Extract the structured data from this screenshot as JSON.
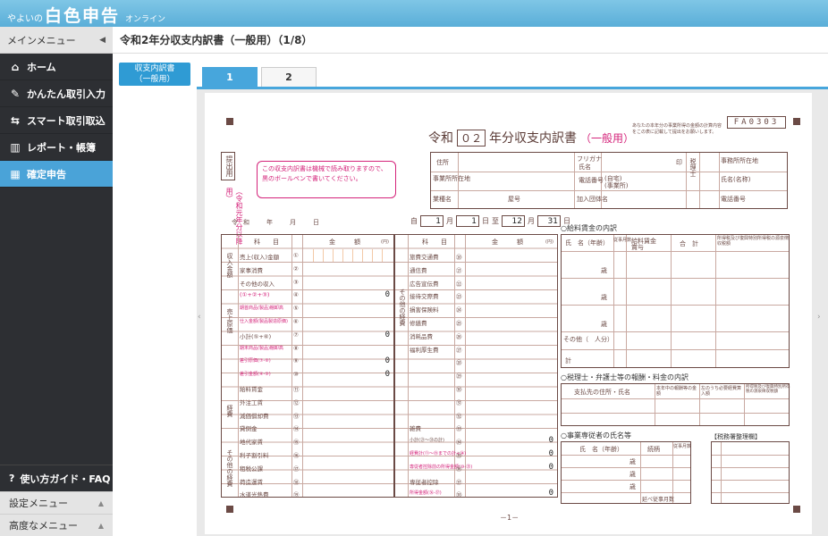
{
  "header": {
    "logo_small": "やよいの",
    "logo_big": "白色申告",
    "logo_online": "オンライン"
  },
  "sidebar": {
    "title": "メインメニュー",
    "collapse_icon": "triangle-left-icon",
    "items": [
      {
        "label": "ホーム",
        "icon": "home-icon"
      },
      {
        "label": "かんたん取引入力",
        "icon": "pencil-icon"
      },
      {
        "label": "スマート取引取込",
        "icon": "import-icon"
      },
      {
        "label": "レポート・帳簿",
        "icon": "chart-icon"
      },
      {
        "label": "確定申告",
        "icon": "calculator-icon"
      }
    ],
    "guide_label": "使い方ガイド・FAQ",
    "settings_label": "設定メニュー",
    "advanced_label": "高度なメニュー"
  },
  "main": {
    "page_title": "令和2年分収支内訳書（一般用）（1/8）",
    "doc_button": [
      "収支内訳書",
      "（一般用）"
    ],
    "tabs": [
      "1",
      "2"
    ],
    "active_tab": 0
  },
  "form": {
    "form_code": "FA0303",
    "title_prefix": "令和",
    "title_year": "０２",
    "title_main": "年分収支内訳書",
    "title_sub": "（一般用）",
    "corner_note": "あなたの本年分の事業所得の金額の計算内容をこの表に記載して提出をお願いします。",
    "teishutsu": "提出用",
    "side_note": "（令和元年分以降用）",
    "notice": "この収支内訳書は機械で読み取りますので、黒のボールペンで書いてください。",
    "info_labels": {
      "address": "住所",
      "furigana": "フリガナ",
      "name": "氏名",
      "office_address": "事業所所在地",
      "phone": "電話番号",
      "self": "(自宅)",
      "office": "(事業所)",
      "tax_accountant": "税理士",
      "office_loc": "事務所所在地",
      "tax_name": "氏名(名称)",
      "tax_phone": "電話番号",
      "business": "業種名",
      "shop": "屋号",
      "association": "加入団体名",
      "seal": "印"
    },
    "date_line": "令和　年　月　日",
    "period": {
      "from_label": "自",
      "from_month": "1",
      "month": "月",
      "from_day": "1",
      "day": "日",
      "to_label": "至",
      "to_month": "12",
      "to_day": "31"
    },
    "col_headers": {
      "item": "科　　目",
      "amount": "金　　　額",
      "yen": "(円)"
    },
    "left_rows": [
      {
        "no": "①",
        "label": "売上(収入)金額",
        "value": ""
      },
      {
        "no": "②",
        "label": "家事消費",
        "value": ""
      },
      {
        "no": "③",
        "label": "その他の収入",
        "value": ""
      },
      {
        "no": "④",
        "label": "(①+②+③)",
        "value": "0"
      },
      {
        "no": "⑤",
        "label": "期首商品(製品)棚卸高",
        "value": ""
      },
      {
        "no": "⑥",
        "label": "仕入金額(製品製造原価)",
        "value": ""
      },
      {
        "no": "⑦",
        "label": "小計(⑤+⑥)",
        "value": "0"
      },
      {
        "no": "⑧",
        "label": "期末商品(製品)棚卸高",
        "value": ""
      },
      {
        "no": "⑨",
        "label": "差引原価(⑦-⑧)",
        "value": "0"
      },
      {
        "no": "⑩",
        "label": "差引金額(④-⑨)",
        "value": "0"
      },
      {
        "no": "⑪",
        "label": "給料賃金",
        "value": ""
      },
      {
        "no": "⑫",
        "label": "外注工賃",
        "value": ""
      },
      {
        "no": "⑬",
        "label": "減価償却費",
        "value": ""
      },
      {
        "no": "⑭",
        "label": "貸倒金",
        "value": ""
      },
      {
        "no": "⑮",
        "label": "地代家賃",
        "value": ""
      },
      {
        "no": "⑯",
        "label": "利子割引料",
        "value": ""
      },
      {
        "no": "⑰",
        "label": "租税公課",
        "value": ""
      },
      {
        "no": "⑱",
        "label": "荷造運賃",
        "value": ""
      },
      {
        "no": "⑲",
        "label": "水道光熱費",
        "value": ""
      }
    ],
    "left_groups": [
      "収入金額",
      "売上原価",
      "経費",
      "その他の経費"
    ],
    "mid_group": "その他の経費",
    "right_rows": [
      {
        "no": "⑳",
        "label": "旅費交通費",
        "value": ""
      },
      {
        "no": "㉑",
        "label": "通信費",
        "value": ""
      },
      {
        "no": "㉒",
        "label": "広告宣伝費",
        "value": ""
      },
      {
        "no": "㉓",
        "label": "接待交際費",
        "value": ""
      },
      {
        "no": "㉔",
        "label": "損害保険料",
        "value": ""
      },
      {
        "no": "㉕",
        "label": "修繕費",
        "value": ""
      },
      {
        "no": "㉖",
        "label": "消耗品費",
        "value": ""
      },
      {
        "no": "㉗",
        "label": "福利厚生費",
        "value": ""
      },
      {
        "no": "㉘",
        "label": "",
        "value": ""
      },
      {
        "no": "㉙",
        "label": "",
        "value": ""
      },
      {
        "no": "㉚",
        "label": "",
        "value": ""
      },
      {
        "no": "㉛",
        "label": "",
        "value": ""
      },
      {
        "no": "㉜",
        "label": "",
        "value": ""
      },
      {
        "no": "㉝",
        "label": "雑費",
        "value": ""
      },
      {
        "no": "㉞",
        "label": "小計(㉑～㉝の計)",
        "value": "0"
      },
      {
        "no": "㉟",
        "label": "経費計(⑪～⑲までの計+㉞)",
        "value": "0"
      },
      {
        "no": "㊱",
        "label": "専従者控除前の所得金額(⑩-㉟)",
        "value": "0"
      },
      {
        "no": "㊲",
        "label": "専従者控除",
        "value": ""
      },
      {
        "no": "㊳",
        "label": "所得金額(㊱-㊲)",
        "value": "0"
      }
    ],
    "salary_title": "○給料賃金の内訳",
    "salary_headers": [
      "氏　名（年齢）",
      "従事月数",
      "給料賃金",
      "賞与",
      "合　計",
      "所得税及び復興特別所得税の源泉徴収税額"
    ],
    "salary_age": "歳",
    "salary_other": "その他（　人分）",
    "salary_total": "計",
    "fee_title": "○税理士・弁護士等の報酬・料金の内訳",
    "fee_headers": [
      "支払先の住所・氏名",
      "本年中の報酬等の金額",
      "左のうち必要経費算入額",
      "所得税及び復興特別所得税の源泉徴収税額"
    ],
    "family_title": "○事業専従者の氏名等",
    "family_headers": [
      "氏　名（年齢）",
      "続柄",
      "従事月数"
    ],
    "family_total": "延べ従事月数",
    "tax_office": "【税務署整理欄】",
    "page_number": "－1－"
  }
}
